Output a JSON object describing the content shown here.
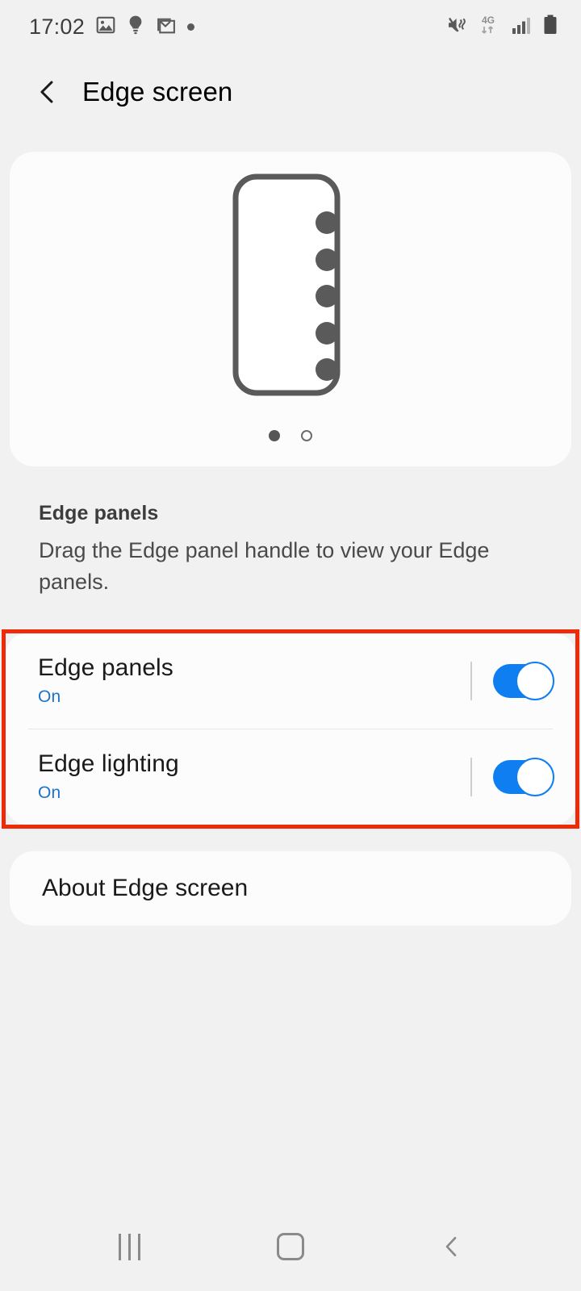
{
  "status_bar": {
    "clock": "17:02",
    "left_icons": [
      "gallery-icon",
      "lightbulb-icon",
      "gmail-icon",
      "dot-indicator-icon"
    ],
    "right_icons": [
      "mute-vibrate-icon",
      "4g-data-icon",
      "signal-bars-icon",
      "battery-icon"
    ],
    "network_label": "4G"
  },
  "app_bar": {
    "back_icon": "chevron-left-icon",
    "title": "Edge screen"
  },
  "preview": {
    "illustration": "phone-edge-panel-illustration",
    "handle_dots": 5,
    "pages": [
      {
        "label": "page-1",
        "active": true
      },
      {
        "label": "page-2",
        "active": false
      }
    ]
  },
  "section": {
    "title": "Edge panels",
    "description": "Drag the Edge panel handle to view your Edge panels."
  },
  "settings": {
    "highlighted": true,
    "highlight_color": "#ee2b09",
    "accent_color": "#0f7ef0",
    "value_color": "#1f72c8",
    "rows": [
      {
        "label": "Edge panels",
        "value": "On",
        "toggle_on": true
      },
      {
        "label": "Edge lighting",
        "value": "On",
        "toggle_on": true
      }
    ]
  },
  "about": {
    "label": "About Edge screen"
  },
  "nav_bar": {
    "recents_label": "recents-icon",
    "home_label": "home-icon",
    "back_label": "back-icon"
  }
}
